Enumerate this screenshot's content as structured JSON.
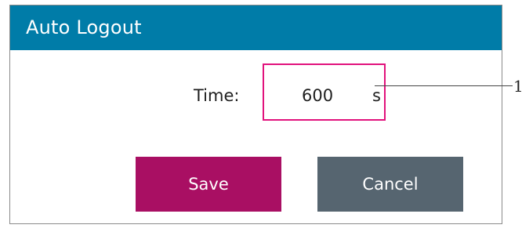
{
  "dialog": {
    "title": "Auto Logout",
    "time_label": "Time:",
    "time_value": "600",
    "time_unit": "s",
    "save_label": "Save",
    "cancel_label": "Cancel"
  },
  "annotation": {
    "callout_number": "1"
  },
  "colors": {
    "title_bar": "#007ca8",
    "field_border": "#e1127c",
    "save_button": "#a90f63",
    "cancel_button": "#566570"
  }
}
